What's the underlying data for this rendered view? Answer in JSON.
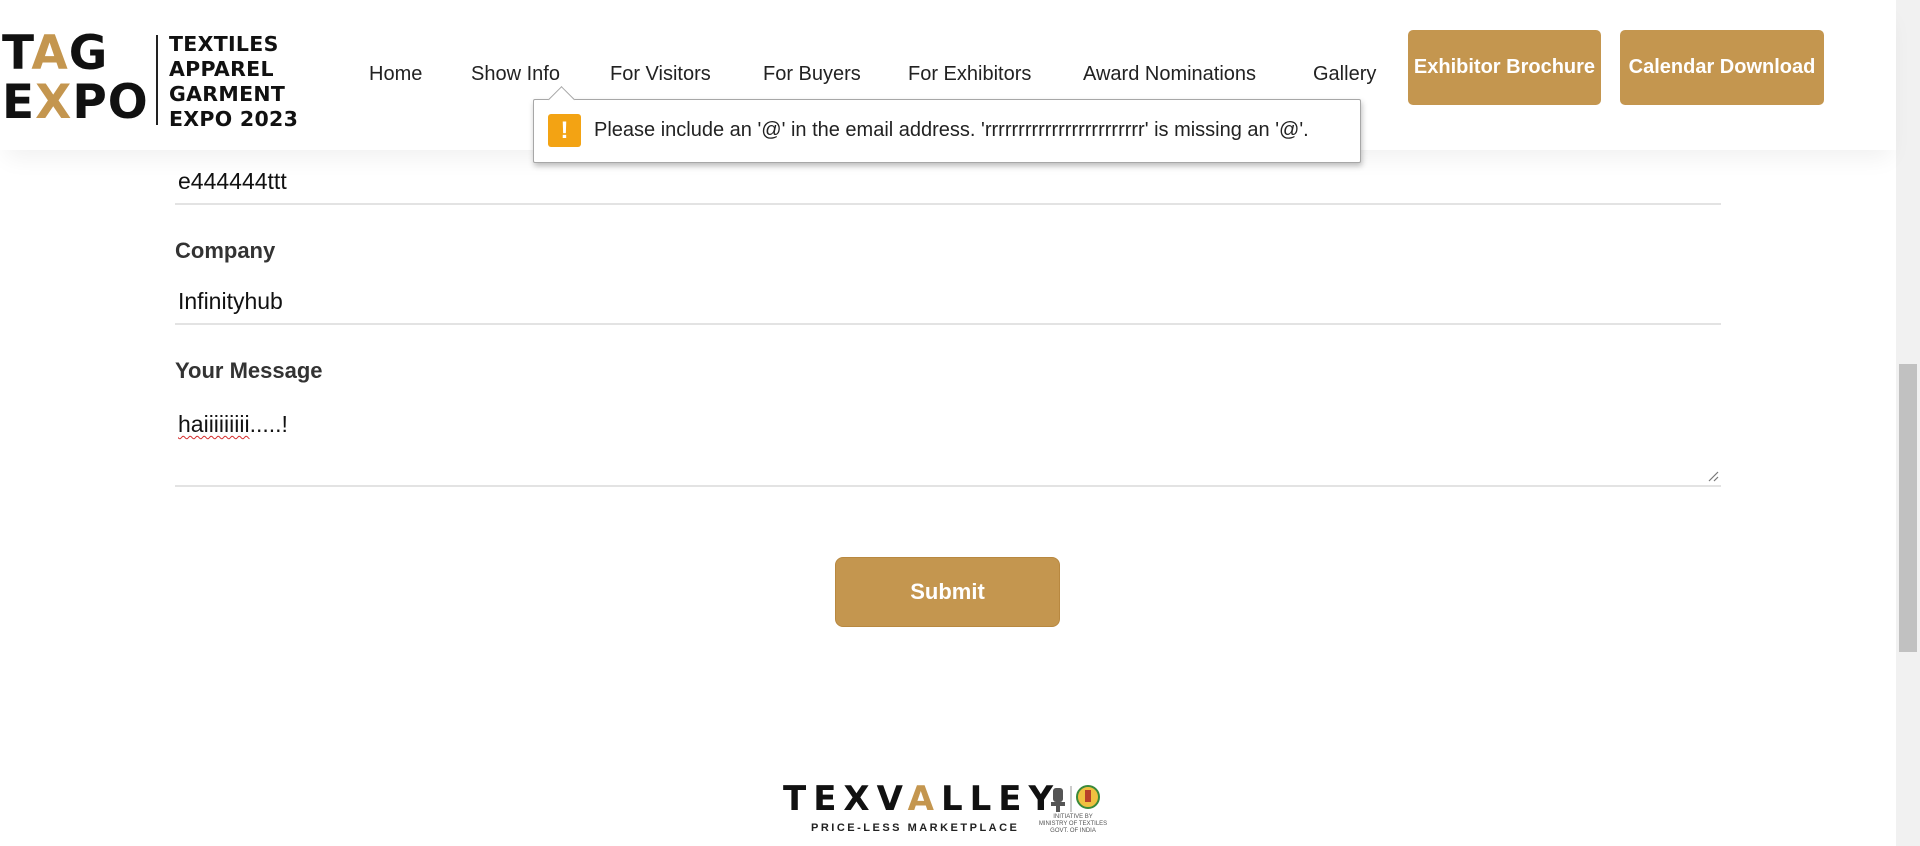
{
  "brand": {
    "logo_line1": "TAG",
    "logo_line2": "EXPO",
    "text_lines": [
      "TEXTILES",
      "APPAREL",
      "GARMENT",
      "EXPO 2023"
    ],
    "accent_color": "#c4964f"
  },
  "nav": {
    "items": [
      "Home",
      "Show Info",
      "For Visitors",
      "For Buyers",
      "For Exhibitors",
      "Award Nominations",
      "Gallery"
    ],
    "buttons": [
      "Exhibitor Brochure",
      "Calendar Download"
    ]
  },
  "tooltip": {
    "icon": "warning-icon",
    "icon_glyph": "!",
    "message": "Please include an '@' in the email address. 'rrrrrrrrrrrrrrrrrrrrrrrr' is missing an '@'."
  },
  "form": {
    "partial_field_value": "e444444ttt",
    "company_label": "Company",
    "company_value": "Infinityhub",
    "message_label": "Your Message",
    "message_value_underlined": "haiiiiiiiii",
    "message_value_rest": ".....!",
    "submit_label": "Submit"
  },
  "footer": {
    "logo_prefix": "TEXV",
    "logo_gold_letter": "A",
    "logo_suffix": "LLEY",
    "tagline": "PRICE-LESS MARKETPLACE",
    "initiative_lines": [
      "INITIATIVE BY",
      "MINISTRY OF TEXTILES",
      "GOVT. OF INDIA"
    ]
  }
}
